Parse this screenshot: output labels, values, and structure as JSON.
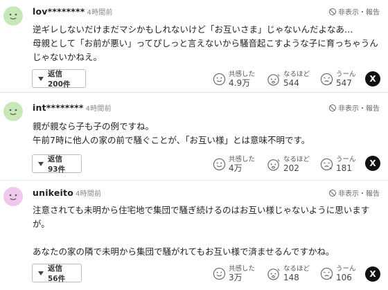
{
  "labels": {
    "report": "非表示・報告",
    "kyokan": "共感した",
    "naruhodo": "なるほど",
    "uun": "うーん"
  },
  "comments": [
    {
      "user": "lov********",
      "time": "4時間前",
      "body": "逆ギレしないだけまだマシかもしれないけど「お互いさま」じゃないんだよなあ…\n母親として「お前が悪い」ってぴしっと言えないから騒音起こすような子に育っちゃうんじゃないかねえ。",
      "replies": "返信 200件",
      "kyokan": "4.9万",
      "naruhodo": "544",
      "uun": "547"
    },
    {
      "user": "int********",
      "time": "4時間前",
      "body": "親が親なら子も子の例ですね。\n午前7時に他人の家の前で騒ぐことが、「お互い様」とは意味不明です。",
      "replies": "返信 93件",
      "kyokan": "4万",
      "naruhodo": "202",
      "uun": "181"
    },
    {
      "user": "unikeito",
      "time": "4時間前",
      "body": "注意されても未明から住宅地で集団で騒ぎ続けるのはお互い様じゃないように思いますが。\n\nあなたの家の隣で未明から集団で騒がれてもお互い様で済ませるんですかね。",
      "replies": "返信 56件",
      "kyokan": "3万",
      "naruhodo": "148",
      "uun": "106"
    }
  ],
  "share_label": "X",
  "colors": {
    "avatar_green": "#c9e8b9",
    "avatar_pink": "#f0c8ee",
    "x_button": "#111111"
  },
  "icons": [
    "ban-icon",
    "smile-icon",
    "idea-face-icon",
    "confused-face-icon",
    "x-logo-icon",
    "triangle-down-icon"
  ]
}
